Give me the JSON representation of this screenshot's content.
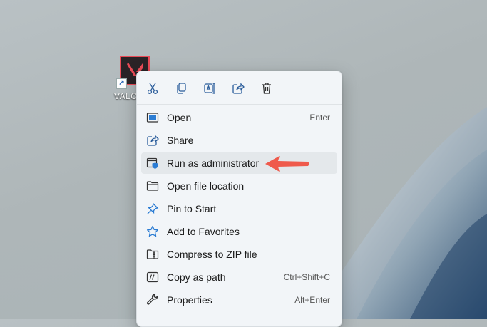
{
  "desktop": {
    "shortcut": {
      "label": "VALO",
      "icon": "valorant-app-icon",
      "overlay_icon": "shortcut-arrow-icon",
      "overlay_glyph": "↗"
    }
  },
  "context_menu": {
    "quick_actions": [
      {
        "name": "cut-icon",
        "label": "Cut"
      },
      {
        "name": "copy-icon",
        "label": "Copy"
      },
      {
        "name": "rename-icon",
        "label": "Rename"
      },
      {
        "name": "share-icon",
        "label": "Share"
      },
      {
        "name": "delete-icon",
        "label": "Delete"
      }
    ],
    "items": [
      {
        "label": "Open",
        "shortcut": "Enter",
        "icon": "open-window-icon"
      },
      {
        "label": "Share",
        "shortcut": "",
        "icon": "share-icon"
      },
      {
        "label": "Run as administrator",
        "shortcut": "",
        "icon": "shield-admin-icon",
        "highlighted": true
      },
      {
        "label": "Open file location",
        "shortcut": "",
        "icon": "folder-icon"
      },
      {
        "label": "Pin to Start",
        "shortcut": "",
        "icon": "pin-icon"
      },
      {
        "label": "Add to Favorites",
        "shortcut": "",
        "icon": "star-icon"
      },
      {
        "label": "Compress to ZIP file",
        "shortcut": "",
        "icon": "zip-folder-icon"
      },
      {
        "label": "Copy as path",
        "shortcut": "Ctrl+Shift+C",
        "icon": "copy-path-icon"
      },
      {
        "label": "Properties",
        "shortcut": "Alt+Enter",
        "icon": "wrench-icon"
      }
    ]
  },
  "annotation": {
    "icon": "red-arrow-icon",
    "color": "#ef5a4c"
  },
  "colors": {
    "accent": "#2b7cd3",
    "valorant_red": "#ea4b57",
    "menu_bg": "#f2f5f8",
    "highlight_bg": "#e4e8eb"
  }
}
